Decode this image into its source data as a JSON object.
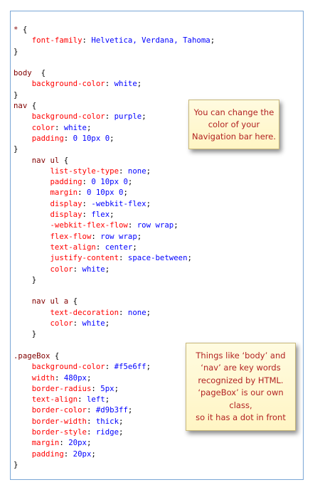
{
  "code_lines": [
    {
      "s": "* {",
      "p": "",
      "v": "",
      "e": ""
    },
    {
      "s": "    ",
      "p": "font-family",
      "v": "Helvetica, Verdana, Tahoma",
      "e": ";"
    },
    {
      "s": "}",
      "p": "",
      "v": "",
      "e": ""
    },
    {
      "s": "",
      "p": "",
      "v": "",
      "e": ""
    },
    {
      "s": "body  {",
      "p": "",
      "v": "",
      "e": ""
    },
    {
      "s": "    ",
      "p": "background-color",
      "v": "white",
      "e": ";"
    },
    {
      "s": "}",
      "p": "",
      "v": "",
      "e": ""
    },
    {
      "s": "nav {",
      "p": "",
      "v": "",
      "e": ""
    },
    {
      "s": "    ",
      "p": "background-color",
      "v": "purple",
      "e": ";"
    },
    {
      "s": "    ",
      "p": "color",
      "v": "white",
      "e": ";"
    },
    {
      "s": "    ",
      "p": "padding",
      "v": "0 10px 0",
      "e": ";"
    },
    {
      "s": "}",
      "p": "",
      "v": "",
      "e": ""
    },
    {
      "s": "    nav ul {",
      "p": "",
      "v": "",
      "e": ""
    },
    {
      "s": "        ",
      "p": "list-style-type",
      "v": "none",
      "e": ";"
    },
    {
      "s": "        ",
      "p": "padding",
      "v": "0 10px 0",
      "e": ";"
    },
    {
      "s": "        ",
      "p": "margin",
      "v": "0 10px 0",
      "e": ";"
    },
    {
      "s": "        ",
      "p": "display",
      "v": "-webkit-flex",
      "e": ";"
    },
    {
      "s": "        ",
      "p": "display",
      "v": "flex",
      "e": ";"
    },
    {
      "s": "        ",
      "p": "-webkit-flex-flow",
      "v": "row wrap",
      "e": ";"
    },
    {
      "s": "        ",
      "p": "flex-flow",
      "v": "row wrap",
      "e": ";"
    },
    {
      "s": "        ",
      "p": "text-align",
      "v": "center",
      "e": ";"
    },
    {
      "s": "        ",
      "p": "justify-content",
      "v": "space-between",
      "e": ";"
    },
    {
      "s": "        ",
      "p": "color",
      "v": "white",
      "e": ";"
    },
    {
      "s": "    }",
      "p": "",
      "v": "",
      "e": ""
    },
    {
      "s": "",
      "p": "",
      "v": "",
      "e": ""
    },
    {
      "s": "    nav ul a {",
      "p": "",
      "v": "",
      "e": ""
    },
    {
      "s": "        ",
      "p": "text-decoration",
      "v": "none",
      "e": ";"
    },
    {
      "s": "        ",
      "p": "color",
      "v": "white",
      "e": ";"
    },
    {
      "s": "    }",
      "p": "",
      "v": "",
      "e": ""
    },
    {
      "s": "",
      "p": "",
      "v": "",
      "e": ""
    },
    {
      "s": ".pageBox {",
      "p": "",
      "v": "",
      "e": ""
    },
    {
      "s": "    ",
      "p": "background-color",
      "v": "#f5e6ff",
      "e": ";"
    },
    {
      "s": "    ",
      "p": "width",
      "v": "480px",
      "e": ";"
    },
    {
      "s": "    ",
      "p": "border-radius",
      "v": "5px",
      "e": ";"
    },
    {
      "s": "    ",
      "p": "text-align",
      "v": "left",
      "e": ";"
    },
    {
      "s": "    ",
      "p": "border-color",
      "v": "#d9b3ff",
      "e": ";"
    },
    {
      "s": "    ",
      "p": "border-width",
      "v": "thick",
      "e": ";"
    },
    {
      "s": "    ",
      "p": "border-style",
      "v": "ridge",
      "e": ";"
    },
    {
      "s": "    ",
      "p": "margin",
      "v": "20px",
      "e": ";"
    },
    {
      "s": "    ",
      "p": "padding",
      "v": "20px",
      "e": ";"
    },
    {
      "s": "}",
      "p": "",
      "v": "",
      "e": ""
    }
  ],
  "callouts": {
    "nav_note": "You can change the\ncolor of your\nNavigation bar here.",
    "keywords_note": "Things like ‘body’ and\n‘nav’ are key words\nrecognized by HTML.\n‘pageBox’ is our own class,\nso it has a dot in front"
  },
  "colors": {
    "selector": "#800000",
    "property": "#ff0000",
    "value": "#0000ff",
    "callout_text": "#b22222",
    "frame_border": "#7aa6d6"
  }
}
